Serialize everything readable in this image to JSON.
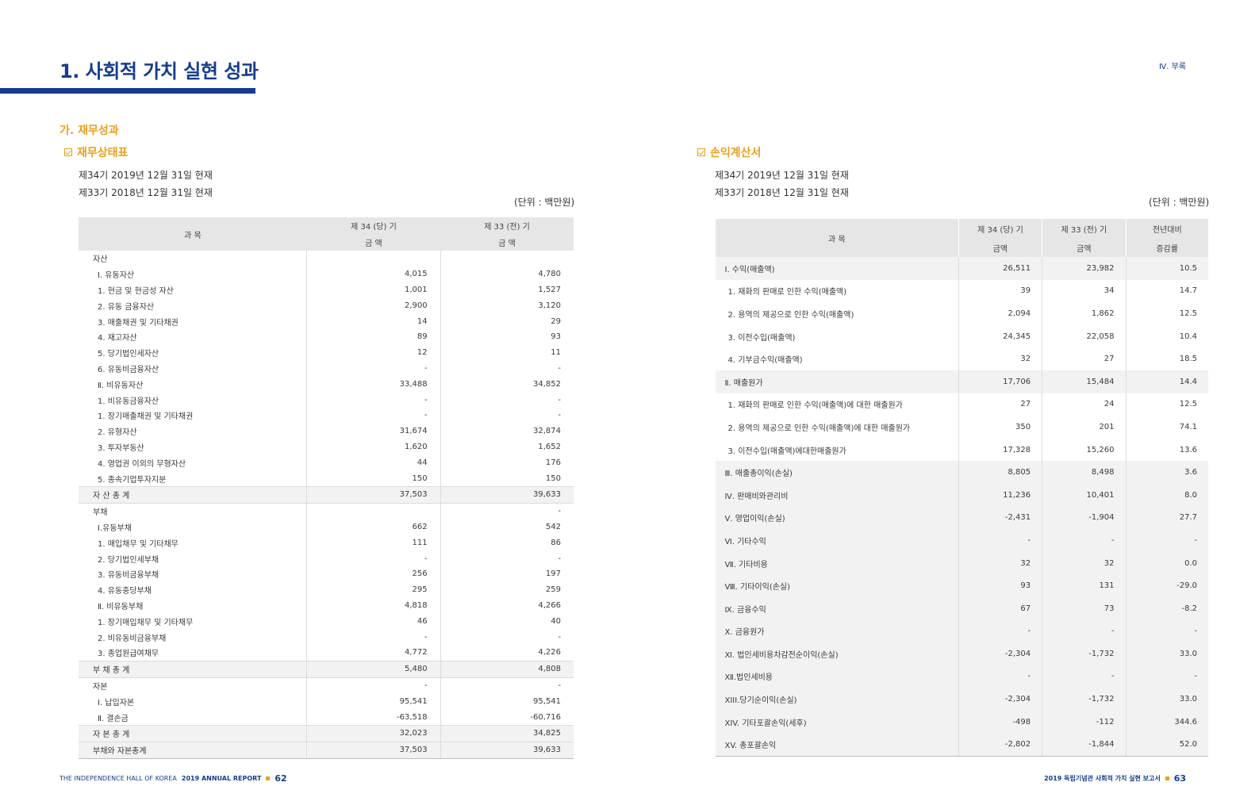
{
  "header": {
    "title": "1. 사회적 가치 실현 성과",
    "section_tag": "Ⅳ. 부록"
  },
  "section_heading": "가. 재무성과",
  "balance_sheet": {
    "heading": "재무상태표",
    "period1": "제34기 2019년 12월 31일 현재",
    "period2": "제33기 2018년 12월 31일 현재",
    "unit": "(단위 : 백만원)",
    "headers": {
      "item": "과 목",
      "cur_period": "제 34 (당) 기",
      "prev_period": "제 33 (전) 기",
      "amount_cur": "금 액",
      "amount_prev": "금 액"
    },
    "rows": [
      {
        "label": "자산",
        "cur": "",
        "prev": "",
        "type": "head"
      },
      {
        "label": "Ⅰ. 유동자산",
        "cur": "4,015",
        "prev": "4,780",
        "type": "ind"
      },
      {
        "label": "1. 현금 및 현금성 자산",
        "cur": "1,001",
        "prev": "1,527",
        "type": "ind"
      },
      {
        "label": "2. 유동 금융자산",
        "cur": "2,900",
        "prev": "3,120",
        "type": "ind"
      },
      {
        "label": "3. 매출채권 및 기타채권",
        "cur": "14",
        "prev": "29",
        "type": "ind"
      },
      {
        "label": "4. 재고자산",
        "cur": "89",
        "prev": "93",
        "type": "ind"
      },
      {
        "label": "5. 당기법인세자산",
        "cur": "12",
        "prev": "11",
        "type": "ind"
      },
      {
        "label": "6. 유동비금융자산",
        "cur": "-",
        "prev": "-",
        "type": "ind"
      },
      {
        "label": "Ⅱ. 비유동자산",
        "cur": "33,488",
        "prev": "34,852",
        "type": "ind"
      },
      {
        "label": "1. 비유동금융자산",
        "cur": "-",
        "prev": "-",
        "type": "ind"
      },
      {
        "label": "1. 장기매출채권 및 기타채권",
        "cur": "-",
        "prev": "-",
        "type": "ind"
      },
      {
        "label": "2. 유형자산",
        "cur": "31,674",
        "prev": "32,874",
        "type": "ind"
      },
      {
        "label": "3. 투자부동산",
        "cur": "1,620",
        "prev": "1,652",
        "type": "ind"
      },
      {
        "label": "4. 영업권 이외의 무형자산",
        "cur": "44",
        "prev": "176",
        "type": "ind"
      },
      {
        "label": "5. 종속기업투자지분",
        "cur": "150",
        "prev": "150",
        "type": "ind"
      },
      {
        "label": "자 산 총 계",
        "cur": "37,503",
        "prev": "39,633",
        "type": "total"
      },
      {
        "label": "부채",
        "cur": "",
        "prev": "-",
        "type": "head"
      },
      {
        "label": "Ⅰ.유동부채",
        "cur": "662",
        "prev": "542",
        "type": "ind"
      },
      {
        "label": "1. 매입채무 및 기타채무",
        "cur": "111",
        "prev": "86",
        "type": "ind"
      },
      {
        "label": "2. 당기법인세부채",
        "cur": "-",
        "prev": "-",
        "type": "ind"
      },
      {
        "label": "3. 유동비금융부채",
        "cur": "256",
        "prev": "197",
        "type": "ind"
      },
      {
        "label": "4. 유동충당부채",
        "cur": "295",
        "prev": "259",
        "type": "ind"
      },
      {
        "label": "Ⅱ. 비유동부채",
        "cur": "4,818",
        "prev": "4,266",
        "type": "ind"
      },
      {
        "label": "1. 장기매입채무 및 기타채무",
        "cur": "46",
        "prev": "40",
        "type": "ind"
      },
      {
        "label": "2. 비유동비금융부채",
        "cur": "-",
        "prev": "-",
        "type": "ind"
      },
      {
        "label": "3. 종업원급여채무",
        "cur": "4,772",
        "prev": "4,226",
        "type": "ind"
      },
      {
        "label": "부 채 총 계",
        "cur": "5,480",
        "prev": "4,808",
        "type": "total"
      },
      {
        "label": "자본",
        "cur": "-",
        "prev": "-",
        "type": "head"
      },
      {
        "label": "Ⅰ. 납입자본",
        "cur": "95,541",
        "prev": "95,541",
        "type": "ind"
      },
      {
        "label": "Ⅱ. 결손금",
        "cur": "-63,518",
        "prev": "-60,716",
        "type": "ind"
      },
      {
        "label": "자 본 총 계",
        "cur": "32,023",
        "prev": "34,825",
        "type": "total"
      },
      {
        "label": "부채와 자본총계",
        "cur": "37,503",
        "prev": "39,633",
        "type": "total"
      }
    ]
  },
  "income_statement": {
    "heading": "손익계산서",
    "period1": "제34기 2019년 12월 31일 현재",
    "period2": "제33기 2018년 12월 31일 현재",
    "unit": "(단위 : 백만원)",
    "headers": {
      "item": "과 목",
      "cur_period": "제 34 (당) 기",
      "prev_period": "제 33 (전) 기",
      "change_line1": "전년대비",
      "amount_cur": "금액",
      "amount_prev": "금액",
      "change_line2": "증감률"
    },
    "rows": [
      {
        "label": "Ⅰ. 수익(매출액)",
        "cur": "26,511",
        "prev": "23,982",
        "rate": "10.5",
        "type": "hl"
      },
      {
        "label": "1. 재화의 판매로 인한 수익(매출액)",
        "cur": "39",
        "prev": "34",
        "rate": "14.7",
        "type": "ind"
      },
      {
        "label": "2. 용역의 제공으로 인한 수익(매출액)",
        "cur": "2,094",
        "prev": "1,862",
        "rate": "12.5",
        "type": "ind"
      },
      {
        "label": "3. 이전수입(매출액)",
        "cur": "24,345",
        "prev": "22,058",
        "rate": "10.4",
        "type": "ind"
      },
      {
        "label": "4. 기부금수익(매출액)",
        "cur": "32",
        "prev": "27",
        "rate": "18.5",
        "type": "ind"
      },
      {
        "label": "Ⅱ. 매출원가",
        "cur": "17,706",
        "prev": "15,484",
        "rate": "14.4",
        "type": "hl"
      },
      {
        "label": "1. 재화의 판매로 인한 수익(매출액)에 대한 매출원가",
        "cur": "27",
        "prev": "24",
        "rate": "12.5",
        "type": "ind"
      },
      {
        "label": "2. 용역의 제공으로 인한 수익(매출액)에 대한 매출원가",
        "cur": "350",
        "prev": "201",
        "rate": "74.1",
        "type": "ind"
      },
      {
        "label": "3. 이전수입(매출액)에대한매출원가",
        "cur": "17,328",
        "prev": "15,260",
        "rate": "13.6",
        "type": "ind"
      },
      {
        "label": "Ⅲ. 매출총이익(손실)",
        "cur": "8,805",
        "prev": "8,498",
        "rate": "3.6",
        "type": "hl"
      },
      {
        "label": "Ⅳ. 판매비와관리비",
        "cur": "11,236",
        "prev": "10,401",
        "rate": "8.0",
        "type": "hl"
      },
      {
        "label": "Ⅴ. 영업이익(손실)",
        "cur": "-2,431",
        "prev": "-1,904",
        "rate": "27.7",
        "type": "hl"
      },
      {
        "label": "Ⅵ. 기타수익",
        "cur": "-",
        "prev": "-",
        "rate": "-",
        "type": "hl"
      },
      {
        "label": "Ⅶ. 기타비용",
        "cur": "32",
        "prev": "32",
        "rate": "0.0",
        "type": "hl"
      },
      {
        "label": "Ⅷ. 기타이익(손실)",
        "cur": "93",
        "prev": "131",
        "rate": "-29.0",
        "type": "hl"
      },
      {
        "label": "Ⅸ. 금융수익",
        "cur": "67",
        "prev": "73",
        "rate": "-8.2",
        "type": "hl"
      },
      {
        "label": "Ⅹ. 금융원가",
        "cur": "-",
        "prev": "-",
        "rate": "-",
        "type": "hl"
      },
      {
        "label": "Ⅺ. 법인세비용차감전순이익(손실)",
        "cur": "-2,304",
        "prev": "-1,732",
        "rate": "33.0",
        "type": "hl"
      },
      {
        "label": "Ⅻ.법인세비용",
        "cur": "-",
        "prev": "-",
        "rate": "-",
        "type": "hl"
      },
      {
        "label": "XIII.당기순이익(손실)",
        "cur": "-2,304",
        "prev": "-1,732",
        "rate": "33.0",
        "type": "hl"
      },
      {
        "label": "XIV. 기타포괄손익(세후)",
        "cur": "-498",
        "prev": "-112",
        "rate": "344.6",
        "type": "hl"
      },
      {
        "label": "XV. 총포괄손익",
        "cur": "-2,802",
        "prev": "-1,844",
        "rate": "52.0",
        "type": "hl"
      }
    ]
  },
  "footer": {
    "left_org": "THE INDEPENDENCE HALL OF KOREA",
    "left_report": "2019 ANNUAL REPORT",
    "left_page": "62",
    "right_report": "2019 독립기념관 사회적 가치 실현 보고서",
    "right_page": "63"
  },
  "colors": {
    "primary": "#163d8c",
    "accent": "#e8a020",
    "header_bg": "#e6e6e6"
  }
}
